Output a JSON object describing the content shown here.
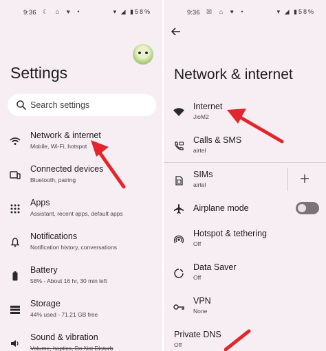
{
  "status_bar": {
    "left_time": "9:36",
    "right_time": "9:36",
    "battery": "58%"
  },
  "left": {
    "title": "Settings",
    "search_placeholder": "Search settings",
    "items": [
      {
        "title": "Network & internet",
        "subtitle": "Mobile, Wi-Fi, hotspot",
        "icon": "wifi-icon"
      },
      {
        "title": "Connected devices",
        "subtitle": "Bluetooth, pairing",
        "icon": "devices-icon"
      },
      {
        "title": "Apps",
        "subtitle": "Assistant, recent apps, default apps",
        "icon": "apps-grid-icon"
      },
      {
        "title": "Notifications",
        "subtitle": "Notification history, conversations",
        "icon": "bell-icon"
      },
      {
        "title": "Battery",
        "subtitle": "58% - About 16 hr, 30 min left",
        "icon": "battery-icon"
      },
      {
        "title": "Storage",
        "subtitle": "44% used - 71.21 GB free",
        "icon": "storage-icon"
      },
      {
        "title": "Sound & vibration",
        "subtitle": "Volume, haptics, Do Not Disturb",
        "icon": "volume-icon"
      }
    ]
  },
  "right": {
    "title": "Network & internet",
    "items": [
      {
        "title": "Internet",
        "subtitle": "JioM2",
        "icon": "wifi-icon"
      },
      {
        "title": "Calls & SMS",
        "subtitle": "airtel",
        "icon": "calls-sms-icon"
      },
      {
        "title": "SIMs",
        "subtitle": "airtel",
        "icon": "sim-icon"
      },
      {
        "title": "Airplane mode",
        "subtitle": "",
        "icon": "airplane-icon"
      },
      {
        "title": "Hotspot & tethering",
        "subtitle": "Off",
        "icon": "hotspot-icon"
      },
      {
        "title": "Data Saver",
        "subtitle": "Off",
        "icon": "data-saver-icon"
      },
      {
        "title": "VPN",
        "subtitle": "None",
        "icon": "vpn-key-icon"
      },
      {
        "title": "Private DNS",
        "subtitle": "Off",
        "icon": ""
      }
    ],
    "airplane_mode_on": false
  },
  "colors": {
    "background": "#f6eef2",
    "arrow": "#e3262b",
    "toggle_off": "#7a7479"
  }
}
